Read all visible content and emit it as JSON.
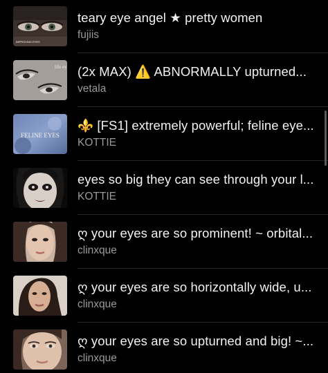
{
  "items": [
    {
      "title": "teary eye angel ★ pretty women",
      "author": "fujiis",
      "thumb_icon": "eyes-closeup-thumbnail",
      "thumb_text": "IMPROVING EYES"
    },
    {
      "title": "(2x MAX) ⚠️ ABNORMALLY upturned...",
      "author": "vetala",
      "thumb_icon": "upturned-eyes-thumbnail",
      "thumb_text": "life ey"
    },
    {
      "title": "⚜️ [FS1] extremely powerful; feline eye...",
      "author": "KOTTIE",
      "thumb_icon": "feline-eyes-thumbnail",
      "thumb_text": "FELINE EYES"
    },
    {
      "title": "eyes so big they can see through your l...",
      "author": "KOTTIE",
      "thumb_icon": "dark-makeup-face-thumbnail",
      "thumb_text": ""
    },
    {
      "title": "ღ your eyes are so prominent! ~ orbital...",
      "author": "clinxque",
      "thumb_icon": "woman-face-thumbnail",
      "thumb_text": ""
    },
    {
      "title": "ღ your eyes are so horizontally wide, u...",
      "author": "clinxque",
      "thumb_icon": "woman-portrait-thumbnail",
      "thumb_text": ""
    },
    {
      "title": "ღ your eyes are so upturned and big! ~...",
      "author": "clinxque",
      "thumb_icon": "woman-closeup-thumbnail",
      "thumb_text": ""
    }
  ]
}
